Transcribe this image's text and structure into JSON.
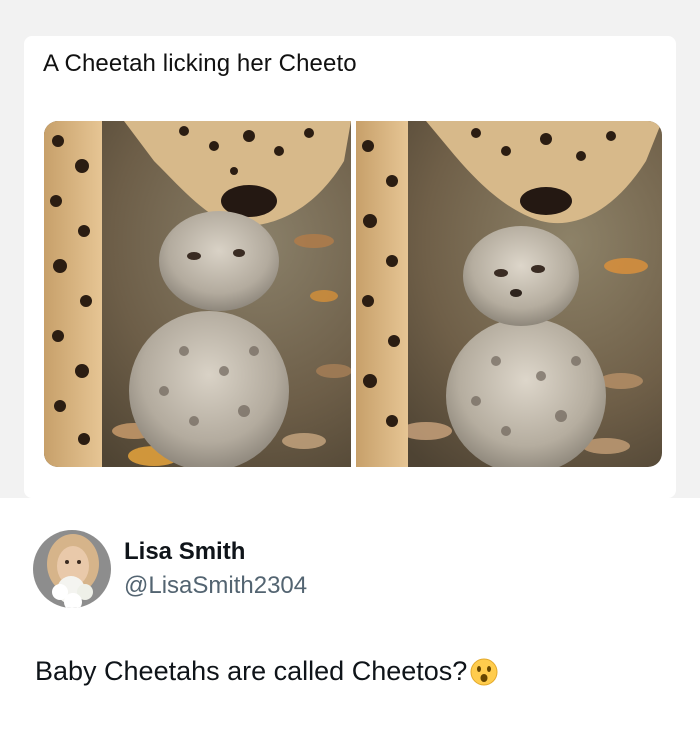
{
  "post": {
    "caption": "A Cheetah licking her Cheeto",
    "photos": [
      {
        "name": "cheetah-licking-cub-photo"
      },
      {
        "name": "cub-looking-up-photo"
      }
    ]
  },
  "reply": {
    "display_name": "Lisa Smith",
    "handle": "@LisaSmith2304",
    "text": "Baby Cheetahs are called Cheetos?",
    "emoji_icon": "surprised-face-emoji"
  },
  "colors": {
    "background": "#f2f2f2",
    "card": "#ffffff",
    "text_primary": "#0f1419",
    "text_secondary": "#536471"
  }
}
